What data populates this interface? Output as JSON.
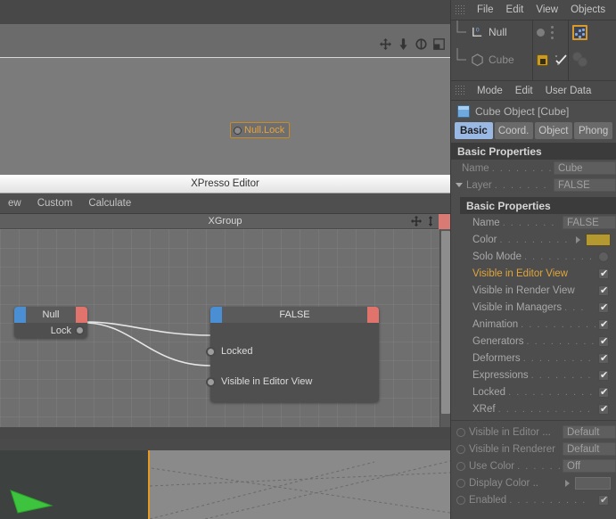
{
  "viewport": {
    "node_label": "Null.Lock",
    "nav_icons": [
      "pan-icon",
      "dolly-icon",
      "rotate-icon",
      "maximize-icon"
    ]
  },
  "xpresso": {
    "window_title": "XPresso Editor",
    "menu_items": [
      "ew",
      "Custom",
      "Calculate"
    ],
    "group_title": "XGroup",
    "group_icons": [
      "move-icon",
      "resize-icon"
    ],
    "nodes": [
      {
        "title": "Null",
        "outputs": [
          "Lock"
        ],
        "inputs": []
      },
      {
        "title": "FALSE",
        "outputs": [],
        "inputs": [
          "Locked",
          "Visible in Editor View"
        ]
      }
    ]
  },
  "object_manager": {
    "menu_items": [
      "File",
      "Edit",
      "View",
      "Objects"
    ],
    "objects": [
      {
        "name": "Null",
        "icon": "null-object-icon",
        "selected": false,
        "dimmed": false
      },
      {
        "name": "Cube",
        "icon": "cube-object-icon",
        "selected": false,
        "dimmed": true
      }
    ],
    "tags": {
      "null_row": [
        "visibility-dot-icon",
        "visibility-dots-icon",
        "xpresso-tag-icon"
      ],
      "cube_row": [
        "lock-tag-icon",
        "check-tag-icon",
        "sphere-pair-icon"
      ]
    }
  },
  "attribute_manager": {
    "menu_items": [
      "Mode",
      "Edit",
      "User Data"
    ],
    "object_title": "Cube Object [Cube]",
    "object_icon": "cube-icon",
    "tabs": [
      {
        "label": "Basic",
        "active": true
      },
      {
        "label": "Coord.",
        "active": false
      },
      {
        "label": "Object",
        "active": false
      },
      {
        "label": "Phong",
        "active": false
      }
    ],
    "section_top": "Basic Properties",
    "top_rows": [
      {
        "label": "Name",
        "value": "Cube",
        "type": "field",
        "expander": false
      },
      {
        "label": "Layer",
        "value": "FALSE",
        "type": "field",
        "expander": true
      }
    ],
    "section_layer": "Basic Properties",
    "layer_rows": [
      {
        "label": "Name",
        "value": "FALSE",
        "type": "field"
      },
      {
        "label": "Color",
        "value": "",
        "type": "swatch",
        "color": "#b3992f",
        "arrow": true
      },
      {
        "label": "Solo Mode",
        "value": "",
        "type": "round"
      },
      {
        "label": "Visible in Editor View",
        "value": "",
        "type": "check",
        "checked": true,
        "highlight": true
      },
      {
        "label": "Visible in Render View",
        "value": "",
        "type": "check",
        "checked": true
      },
      {
        "label": "Visible in Managers",
        "value": "",
        "type": "check",
        "checked": true
      },
      {
        "label": "Animation",
        "value": "",
        "type": "check",
        "checked": true
      },
      {
        "label": "Generators",
        "value": "",
        "type": "check",
        "checked": true
      },
      {
        "label": "Deformers",
        "value": "",
        "type": "check",
        "checked": true
      },
      {
        "label": "Expressions",
        "value": "",
        "type": "check",
        "checked": true
      },
      {
        "label": "Locked",
        "value": "",
        "type": "check",
        "checked": true
      },
      {
        "label": "XRef",
        "value": "",
        "type": "check",
        "checked": true
      }
    ],
    "dim_rows": [
      {
        "label": "Visible in Editor ...",
        "value": "Default",
        "type": "field"
      },
      {
        "label": "Visible in Renderer",
        "value": "Default",
        "type": "field"
      },
      {
        "label": "Use Color",
        "value": "Off",
        "type": "field"
      },
      {
        "label": "Display Color ..",
        "value": "",
        "type": "swatch-empty",
        "arrow": true
      },
      {
        "label": "Enabled",
        "value": "",
        "type": "check",
        "checked": true
      }
    ]
  },
  "colors": {
    "accent_orange": "#e0a63c",
    "tab_active": "#9ab8e4",
    "port_in": "#4a8fd4",
    "port_out": "#e0736b",
    "layer_color": "#b3992f",
    "lock_tag": "#c79a2a"
  }
}
